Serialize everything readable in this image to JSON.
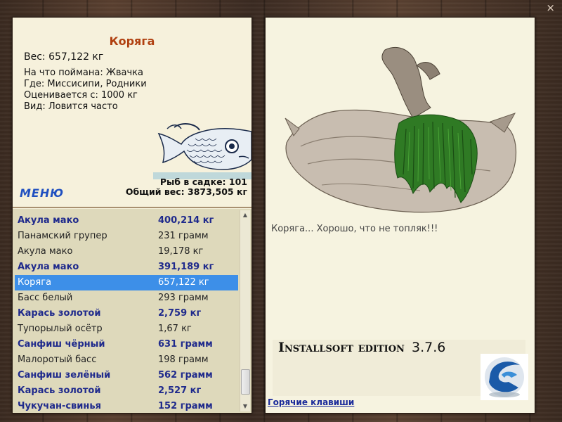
{
  "window": {
    "close_glyph": "×"
  },
  "fish_info": {
    "title": "Коряга",
    "weight_line": "Вес: 657,122 кг",
    "caught_on": "На что поймана: Жвачка",
    "location": "Где: Миссисипи, Родники",
    "valued_from": "Оценивается с: 1000 кг",
    "kind": "Вид: Ловится часто",
    "fish_icon": "fish-drawing-icon"
  },
  "menu": {
    "label": "МЕНЮ"
  },
  "stats": {
    "fish_in_keepnet": "Рыб в садке: 101",
    "total_weight": "Общий вес: 3873,505 кг"
  },
  "catch_list": [
    {
      "name": "Акула мако",
      "weight": "400,214 кг",
      "bold": true,
      "selected": false
    },
    {
      "name": "Панамский групер",
      "weight": "231 грамм",
      "bold": false,
      "selected": false
    },
    {
      "name": "Акула мако",
      "weight": "19,178 кг",
      "bold": false,
      "selected": false
    },
    {
      "name": "Акула мако",
      "weight": "391,189 кг",
      "bold": true,
      "selected": false
    },
    {
      "name": "Коряга",
      "weight": "657,122 кг",
      "bold": false,
      "selected": true
    },
    {
      "name": "Басс белый",
      "weight": "293 грамм",
      "bold": false,
      "selected": false
    },
    {
      "name": "Карась золотой",
      "weight": "2,759 кг",
      "bold": true,
      "selected": false
    },
    {
      "name": "Тупорылый осётр",
      "weight": "1,67 кг",
      "bold": false,
      "selected": false
    },
    {
      "name": "Санфиш чёрный",
      "weight": "631 грамм",
      "bold": true,
      "selected": false
    },
    {
      "name": "Малоротый басс",
      "weight": "198 грамм",
      "bold": false,
      "selected": false
    },
    {
      "name": "Санфиш зелёный",
      "weight": "562 грамм",
      "bold": true,
      "selected": false
    },
    {
      "name": "Карась золотой",
      "weight": "2,527 кг",
      "bold": true,
      "selected": false
    },
    {
      "name": "Чукучан-свинья",
      "weight": "152 грамм",
      "bold": true,
      "selected": false
    }
  ],
  "scroll": {
    "up_glyph": "▲",
    "down_glyph": "▼"
  },
  "detail": {
    "image_icon": "driftwood-with-moss-image",
    "comment": "Коряга... Хорошо, что не топляк!!!"
  },
  "edition": {
    "label": "Installsoft edition",
    "version": "3.7.6",
    "logo_icon": "installsoft-logo-icon"
  },
  "hotkeys": {
    "label": "Горячие клавиши"
  },
  "colors": {
    "selected_row": "#3d8fe8",
    "bold_row": "#1f2a8c",
    "title": "#b04010",
    "menu": "#2050c0"
  }
}
